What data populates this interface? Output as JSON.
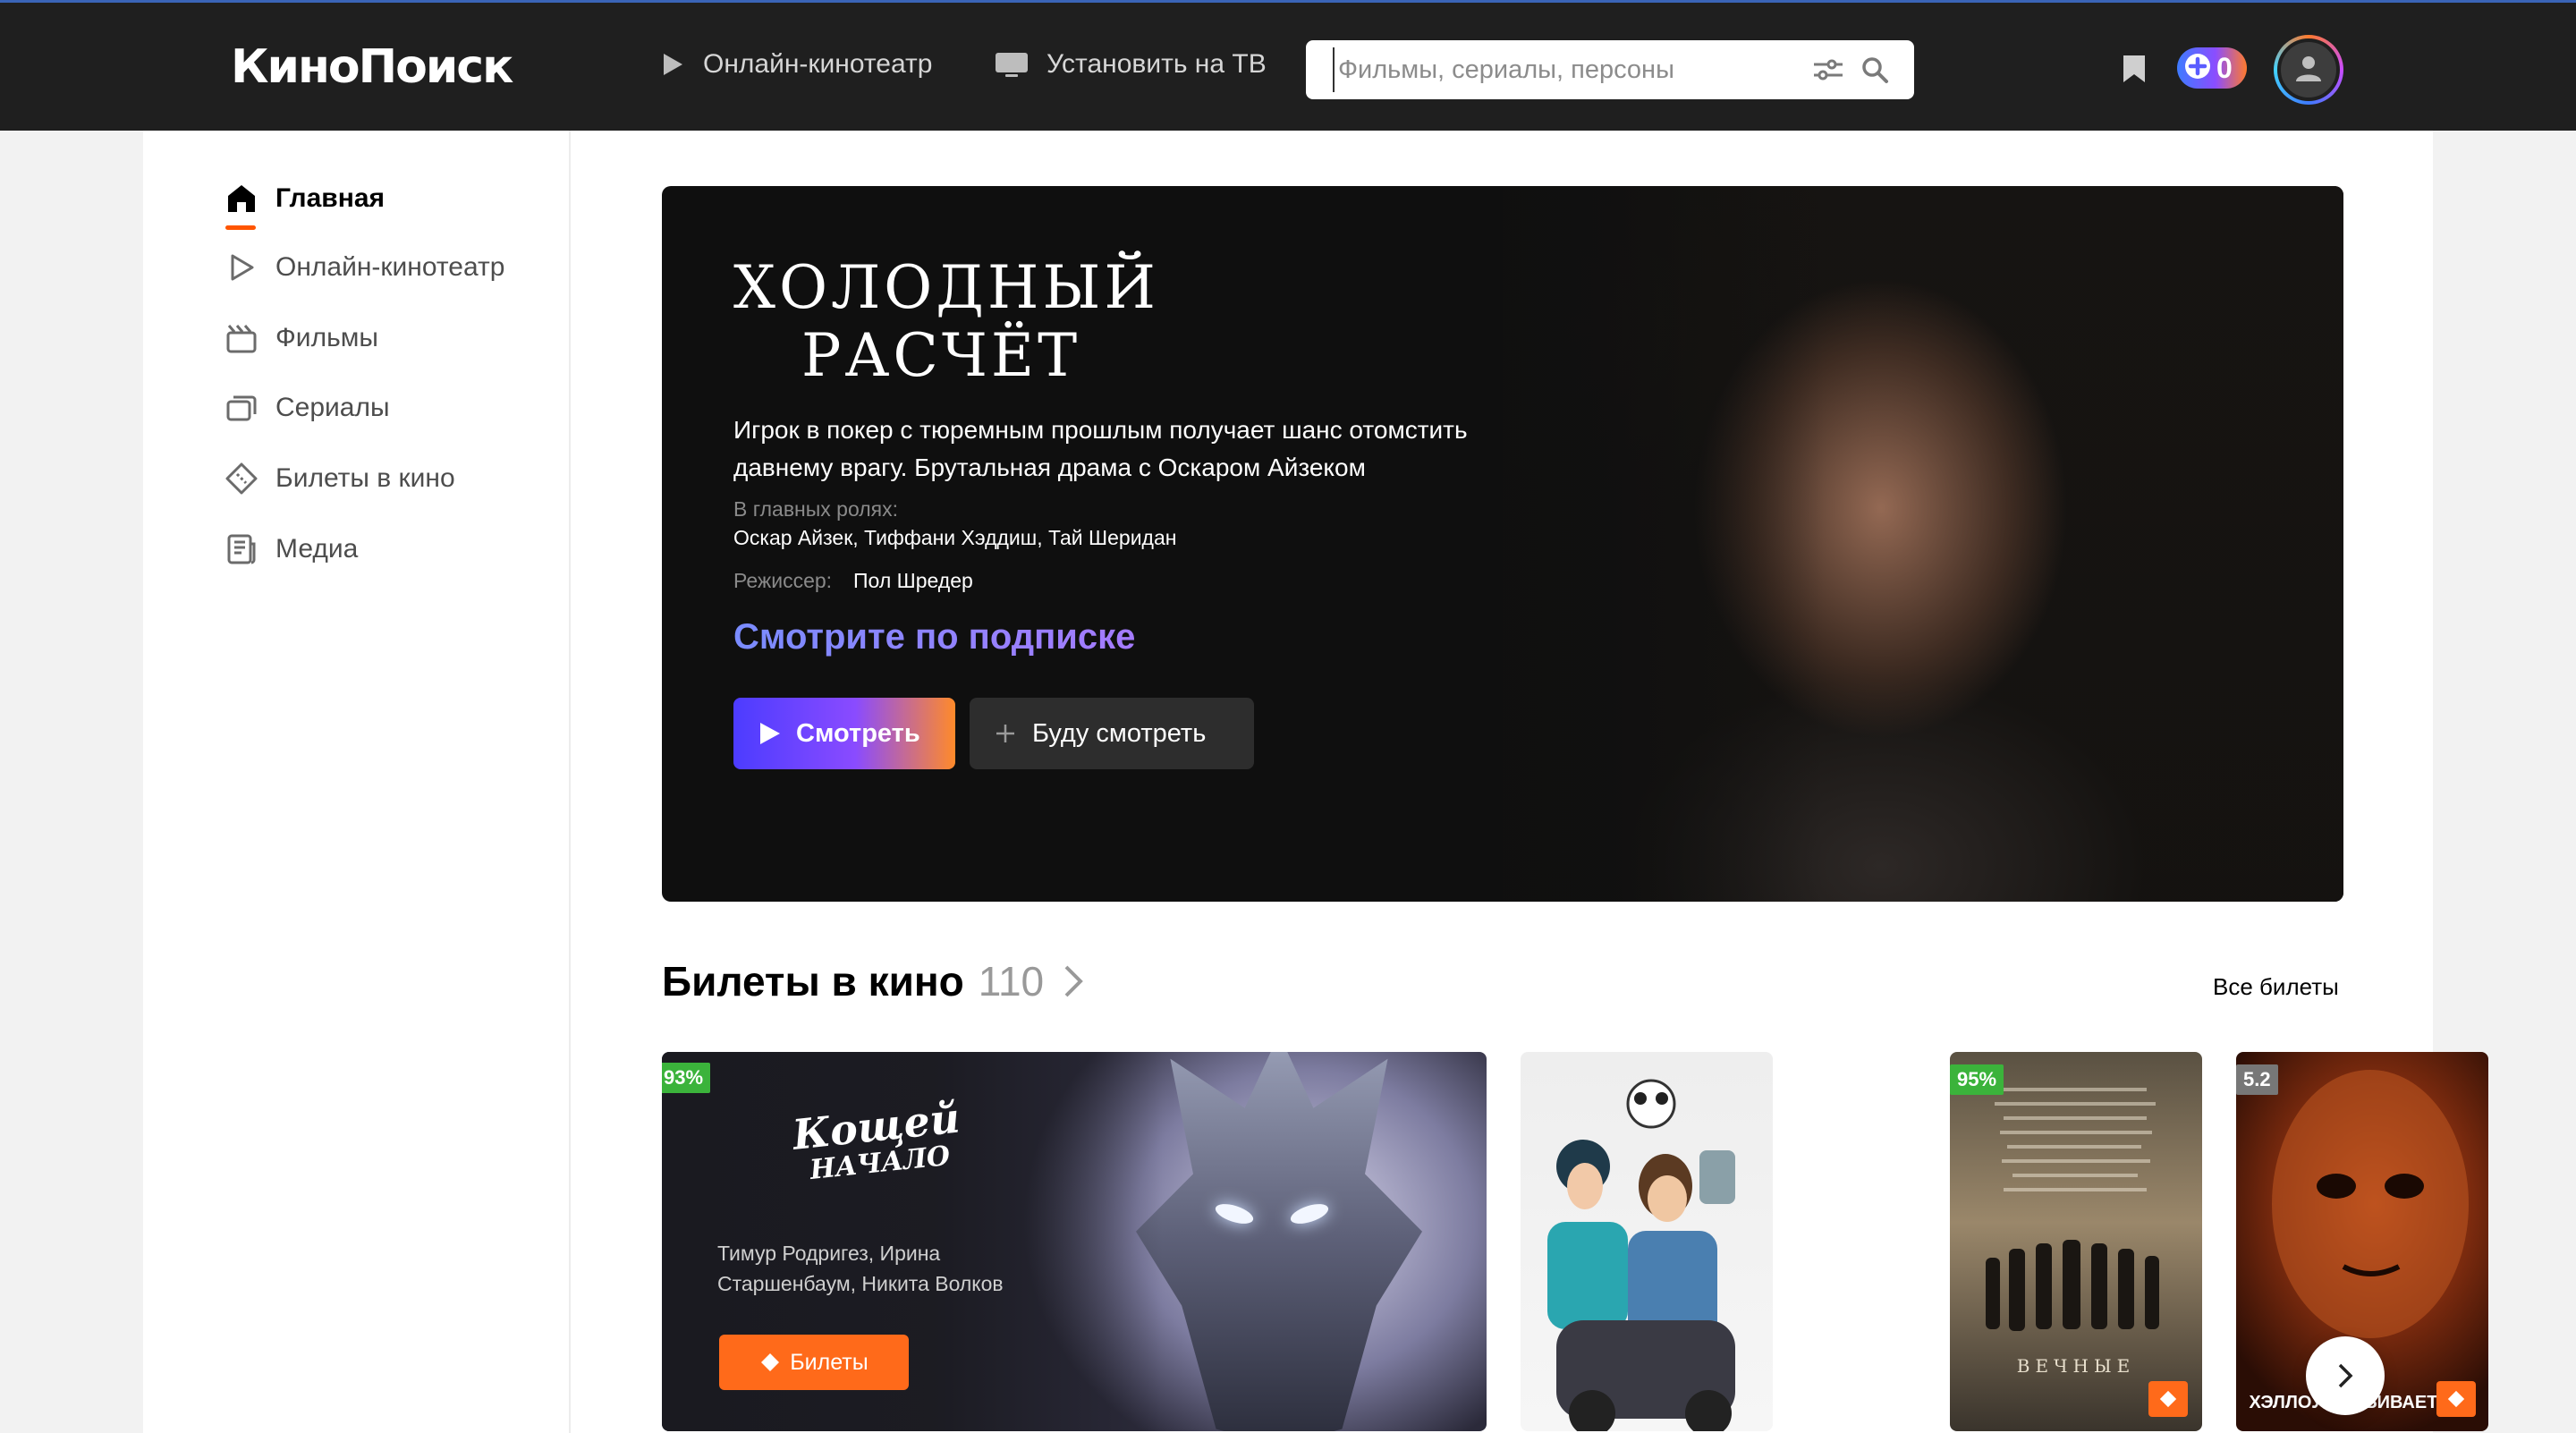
{
  "header": {
    "logo": "КиноПоиск",
    "nav": [
      {
        "label": "Онлайн-кинотеатр",
        "icon": "play-icon"
      },
      {
        "label": "Установить на ТВ",
        "icon": "tv-icon"
      }
    ],
    "search_placeholder": "Фильмы, сериалы, персоны",
    "plus_count": "0"
  },
  "sidebar": {
    "items": [
      {
        "label": "Главная",
        "icon": "home-icon",
        "active": true
      },
      {
        "label": "Онлайн-кинотеатр",
        "icon": "play-outline-icon"
      },
      {
        "label": "Фильмы",
        "icon": "clapper-icon"
      },
      {
        "label": "Сериалы",
        "icon": "series-icon"
      },
      {
        "label": "Билеты в кино",
        "icon": "ticket-icon"
      },
      {
        "label": "Медиа",
        "icon": "media-icon"
      }
    ]
  },
  "hero": {
    "title_line1": "ХОЛОДНЫЙ",
    "title_line2": "РАСЧЁТ",
    "description": "Игрок в покер с тюремным прошлым получает шанс отомстить давнему врагу. Брутальная драма с Оскаром Айзеком",
    "cast_label": "В главных ролях:",
    "cast": "Оскар Айзек, Тиффани Хэддиш, Тай Шеридан",
    "director_label": "Режиссер:",
    "director": "Пол Шредер",
    "subscription": "Смотрите по подписке",
    "watch_button": "Смотреть",
    "later_button": "Буду смотреть"
  },
  "tickets_section": {
    "title": "Билеты в кино",
    "count": "110",
    "all_link": "Все билеты",
    "featured": {
      "rating": "93%",
      "rating_color": "#3bb33b",
      "logo_line1": "Кощей",
      "logo_line2": "НАЧАЛО",
      "cast": "Тимур Родригез, Ирина Старшенбаум, Никита Волков",
      "button": "Билеты"
    },
    "posters": [
      {
        "rating": ""
      },
      {
        "rating": "95%",
        "rating_color": "#3bb33b",
        "caption": "ВЕЧНЫЕ"
      },
      {
        "rating": "5.2",
        "rating_color": "#777777",
        "caption": "ХЭЛЛОУИН УБИВАЕТ"
      }
    ]
  }
}
